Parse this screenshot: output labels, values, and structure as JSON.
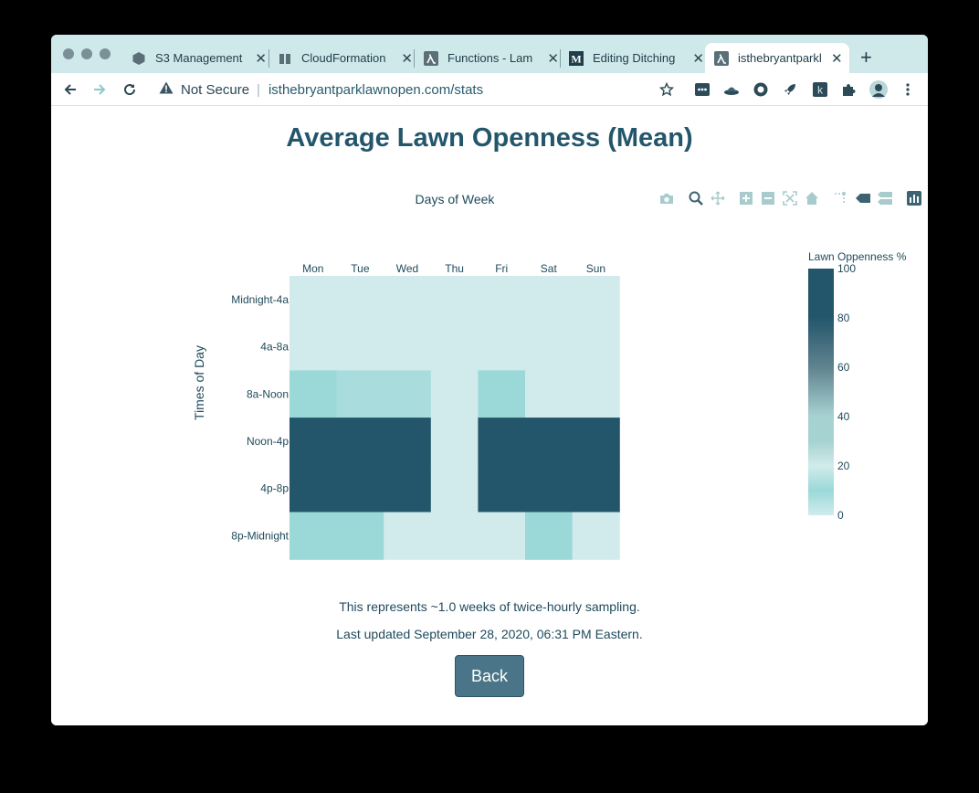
{
  "browser": {
    "tabs": [
      {
        "title": "S3 Management",
        "icon": "s3-icon",
        "active": false
      },
      {
        "title": "CloudFormation",
        "icon": "cloudformation-icon",
        "active": false
      },
      {
        "title": "Functions - Lam",
        "icon": "lambda-icon",
        "active": false
      },
      {
        "title": "Editing Ditching",
        "icon": "medium-icon",
        "active": false
      },
      {
        "title": "isthebryantparkl",
        "icon": "lambda-icon",
        "active": true
      }
    ],
    "new_tab_label": "+",
    "address": {
      "warning": "Not Secure",
      "separator": "|",
      "url": "isthebryantparklawnopen.com/stats"
    }
  },
  "page": {
    "title": "Average Lawn Openness (Mean)",
    "summary": "This represents ~1.0 weeks of twice-hourly sampling.",
    "updated": "Last updated September 28, 2020, 06:31 PM Eastern.",
    "back_label": "Back"
  },
  "chart_data": {
    "type": "heatmap",
    "title": "",
    "xlabel": "Days of Week",
    "ylabel": "Times of Day",
    "x": [
      "Mon",
      "Tue",
      "Wed",
      "Thu",
      "Fri",
      "Sat",
      "Sun"
    ],
    "y": [
      "Midnight-4a",
      "4a-8a",
      "8a-Noon",
      "Noon-4p",
      "4p-8p",
      "8p-Midnight"
    ],
    "z": [
      [
        0,
        0,
        0,
        0,
        0,
        0,
        0
      ],
      [
        0,
        0,
        0,
        0,
        0,
        0,
        0
      ],
      [
        20,
        15,
        15,
        0,
        20,
        0,
        0
      ],
      [
        100,
        100,
        100,
        0,
        100,
        100,
        100
      ],
      [
        100,
        100,
        100,
        0,
        100,
        100,
        100
      ],
      [
        20,
        20,
        0,
        0,
        0,
        20,
        0
      ]
    ],
    "colorbar": {
      "title": "Lawn Oppenness %",
      "range": [
        0,
        100
      ],
      "ticks": [
        0,
        20,
        40,
        60,
        80,
        100
      ]
    },
    "colorscale": [
      "#d1ebec",
      "#9ad9d8",
      "#d0ebea",
      "#a7d2d2",
      "#60838f",
      "#24566b"
    ]
  }
}
